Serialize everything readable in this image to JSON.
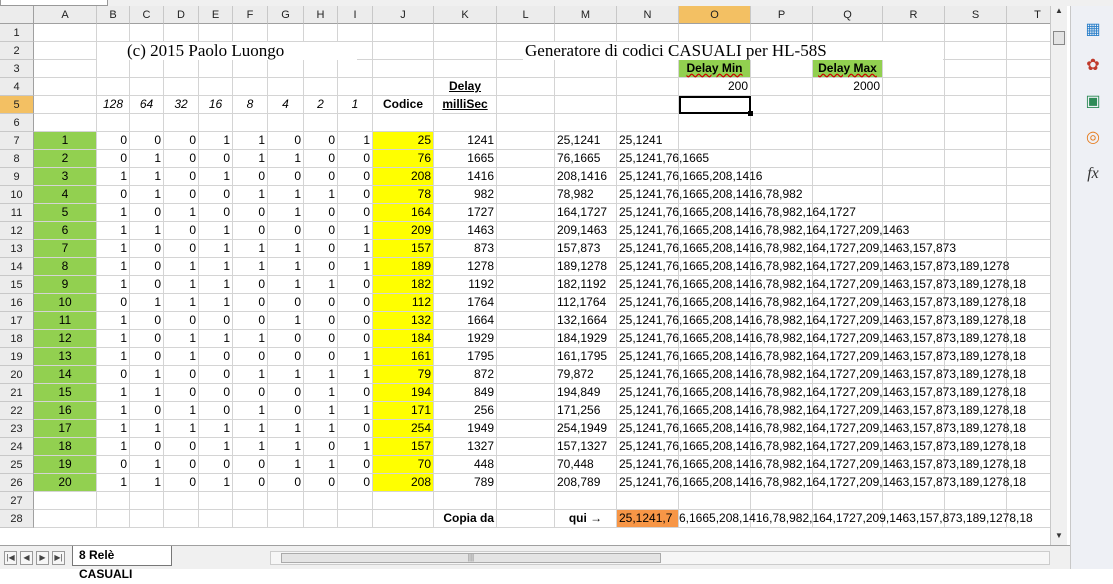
{
  "columns": [
    "A",
    "B",
    "C",
    "D",
    "E",
    "F",
    "G",
    "H",
    "I",
    "J",
    "K",
    "L",
    "M",
    "N",
    "O",
    "P",
    "Q",
    "R",
    "S",
    "T"
  ],
  "rows": [
    "1",
    "2",
    "3",
    "4",
    "5",
    "6",
    "7",
    "8",
    "9",
    "10",
    "11",
    "12",
    "13",
    "14",
    "15",
    "16",
    "17",
    "18",
    "19",
    "20",
    "21",
    "22",
    "23",
    "24",
    "25",
    "26",
    "27",
    "28"
  ],
  "selected_column": "O",
  "selected_row": "5",
  "copyright": "(c) 2015 Paolo Luongo",
  "title": "Generatore di codici CASUALI per HL-58S",
  "delay_min_label": "Delay Min",
  "delay_max_label": "Delay Max",
  "delay_min_value": "200",
  "delay_max_value": "2000",
  "bit_headers": [
    "128",
    "64",
    "32",
    "16",
    "8",
    "4",
    "2",
    "1"
  ],
  "codice_header": "Codice",
  "delay_header_1": "Delay",
  "delay_header_2": "milliSec",
  "data_rows": [
    {
      "n": "1",
      "bits": [
        "0",
        "0",
        "0",
        "1",
        "1",
        "0",
        "0",
        "1"
      ],
      "code": "25",
      "delay": "1241",
      "pair": "25,1241",
      "cum": "25,1241"
    },
    {
      "n": "2",
      "bits": [
        "0",
        "1",
        "0",
        "0",
        "1",
        "1",
        "0",
        "0"
      ],
      "code": "76",
      "delay": "1665",
      "pair": "76,1665",
      "cum": "25,1241,76,1665"
    },
    {
      "n": "3",
      "bits": [
        "1",
        "1",
        "0",
        "1",
        "0",
        "0",
        "0",
        "0"
      ],
      "code": "208",
      "delay": "1416",
      "pair": "208,1416",
      "cum": "25,1241,76,1665,208,1416"
    },
    {
      "n": "4",
      "bits": [
        "0",
        "1",
        "0",
        "0",
        "1",
        "1",
        "1",
        "0"
      ],
      "code": "78",
      "delay": "982",
      "pair": "78,982",
      "cum": "25,1241,76,1665,208,1416,78,982"
    },
    {
      "n": "5",
      "bits": [
        "1",
        "0",
        "1",
        "0",
        "0",
        "1",
        "0",
        "0"
      ],
      "code": "164",
      "delay": "1727",
      "pair": "164,1727",
      "cum": "25,1241,76,1665,208,1416,78,982,164,1727"
    },
    {
      "n": "6",
      "bits": [
        "1",
        "1",
        "0",
        "1",
        "0",
        "0",
        "0",
        "1"
      ],
      "code": "209",
      "delay": "1463",
      "pair": "209,1463",
      "cum": "25,1241,76,1665,208,1416,78,982,164,1727,209,1463"
    },
    {
      "n": "7",
      "bits": [
        "1",
        "0",
        "0",
        "1",
        "1",
        "1",
        "0",
        "1"
      ],
      "code": "157",
      "delay": "873",
      "pair": "157,873",
      "cum": "25,1241,76,1665,208,1416,78,982,164,1727,209,1463,157,873"
    },
    {
      "n": "8",
      "bits": [
        "1",
        "0",
        "1",
        "1",
        "1",
        "1",
        "0",
        "1"
      ],
      "code": "189",
      "delay": "1278",
      "pair": "189,1278",
      "cum": "25,1241,76,1665,208,1416,78,982,164,1727,209,1463,157,873,189,1278"
    },
    {
      "n": "9",
      "bits": [
        "1",
        "0",
        "1",
        "1",
        "0",
        "1",
        "1",
        "0"
      ],
      "code": "182",
      "delay": "1192",
      "pair": "182,1192",
      "cum": "25,1241,76,1665,208,1416,78,982,164,1727,209,1463,157,873,189,1278,18"
    },
    {
      "n": "10",
      "bits": [
        "0",
        "1",
        "1",
        "1",
        "0",
        "0",
        "0",
        "0"
      ],
      "code": "112",
      "delay": "1764",
      "pair": "112,1764",
      "cum": "25,1241,76,1665,208,1416,78,982,164,1727,209,1463,157,873,189,1278,18"
    },
    {
      "n": "11",
      "bits": [
        "1",
        "0",
        "0",
        "0",
        "0",
        "1",
        "0",
        "0"
      ],
      "code": "132",
      "delay": "1664",
      "pair": "132,1664",
      "cum": "25,1241,76,1665,208,1416,78,982,164,1727,209,1463,157,873,189,1278,18"
    },
    {
      "n": "12",
      "bits": [
        "1",
        "0",
        "1",
        "1",
        "1",
        "0",
        "0",
        "0"
      ],
      "code": "184",
      "delay": "1929",
      "pair": "184,1929",
      "cum": "25,1241,76,1665,208,1416,78,982,164,1727,209,1463,157,873,189,1278,18"
    },
    {
      "n": "13",
      "bits": [
        "1",
        "0",
        "1",
        "0",
        "0",
        "0",
        "0",
        "1"
      ],
      "code": "161",
      "delay": "1795",
      "pair": "161,1795",
      "cum": "25,1241,76,1665,208,1416,78,982,164,1727,209,1463,157,873,189,1278,18"
    },
    {
      "n": "14",
      "bits": [
        "0",
        "1",
        "0",
        "0",
        "1",
        "1",
        "1",
        "1"
      ],
      "code": "79",
      "delay": "872",
      "pair": "79,872",
      "cum": "25,1241,76,1665,208,1416,78,982,164,1727,209,1463,157,873,189,1278,18"
    },
    {
      "n": "15",
      "bits": [
        "1",
        "1",
        "0",
        "0",
        "0",
        "0",
        "1",
        "0"
      ],
      "code": "194",
      "delay": "849",
      "pair": "194,849",
      "cum": "25,1241,76,1665,208,1416,78,982,164,1727,209,1463,157,873,189,1278,18"
    },
    {
      "n": "16",
      "bits": [
        "1",
        "0",
        "1",
        "0",
        "1",
        "0",
        "1",
        "1"
      ],
      "code": "171",
      "delay": "256",
      "pair": "171,256",
      "cum": "25,1241,76,1665,208,1416,78,982,164,1727,209,1463,157,873,189,1278,18"
    },
    {
      "n": "17",
      "bits": [
        "1",
        "1",
        "1",
        "1",
        "1",
        "1",
        "1",
        "0"
      ],
      "code": "254",
      "delay": "1949",
      "pair": "254,1949",
      "cum": "25,1241,76,1665,208,1416,78,982,164,1727,209,1463,157,873,189,1278,18"
    },
    {
      "n": "18",
      "bits": [
        "1",
        "0",
        "0",
        "1",
        "1",
        "1",
        "0",
        "1"
      ],
      "code": "157",
      "delay": "1327",
      "pair": "157,1327",
      "cum": "25,1241,76,1665,208,1416,78,982,164,1727,209,1463,157,873,189,1278,18"
    },
    {
      "n": "19",
      "bits": [
        "0",
        "1",
        "0",
        "0",
        "0",
        "1",
        "1",
        "0"
      ],
      "code": "70",
      "delay": "448",
      "pair": "70,448",
      "cum": "25,1241,76,1665,208,1416,78,982,164,1727,209,1463,157,873,189,1278,18"
    },
    {
      "n": "20",
      "bits": [
        "1",
        "1",
        "0",
        "1",
        "0",
        "0",
        "0",
        "0"
      ],
      "code": "208",
      "delay": "789",
      "pair": "208,789",
      "cum": "25,1241,76,1665,208,1416,78,982,164,1727,209,1463,157,873,189,1278,18"
    }
  ],
  "copy_label": "Copia da",
  "qui_label": "qui →",
  "copy_value_start": "25,1241,7",
  "copy_value_rest": "6,1665,208,1416,78,982,164,1727,209,1463,157,873,189,1278,18",
  "sheet_tab": "8 Relè CASUALI",
  "icons": [
    "styles-icon",
    "gallery-icon",
    "navigator-icon",
    "compass-icon",
    "functions-icon"
  ],
  "colors": {
    "green": "#92d050",
    "yellow": "#ffff00",
    "orange": "#f79646",
    "selection": "#f3c063"
  }
}
